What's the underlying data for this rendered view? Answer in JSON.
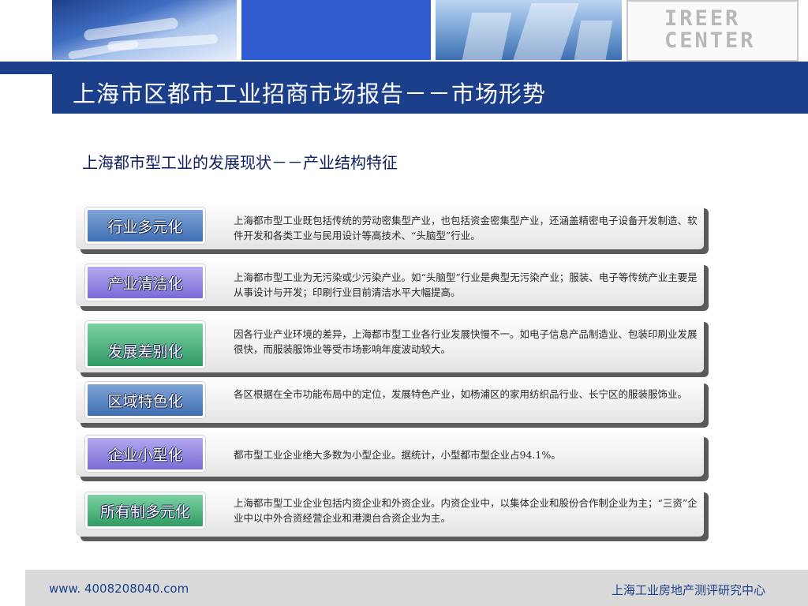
{
  "header": {
    "logo_line1": "IREER",
    "logo_line2": "CENTER",
    "title": "上海市区都市工业招商市场报告－－市场形势"
  },
  "subtitle": "上海都市型工业的发展现状－－产业结构特征",
  "rows": [
    {
      "tag": "行业多元化",
      "desc": "上海都市型工业既包括传统的劳动密集型产业，也包括资金密集型产业，还涵盖精密电子设备开发制造、软件开发和各类工业与民用设计等高技术、“头脑型”行业。"
    },
    {
      "tag": "产业清洁化",
      "desc": "上海都市型工业为无污染或少污染产业。如“头脑型”行业是典型无污染产业；服装、电子等传统产业主要是从事设计与开发；印刷行业目前清洁水平大幅提高。"
    },
    {
      "tag": "发展差别化",
      "desc": "因各行业产业环境的差异，上海都市型工业各行业发展快慢不一。如电子信息产品制造业、包装印刷业发展很快，而服装服饰业等受市场影响年度波动较大。"
    },
    {
      "tag": "区域特色化",
      "desc": "各区根据在全市功能布局中的定位，发展特色产业，如杨浦区的家用纺织品行业、长宁区的服装服饰业。"
    },
    {
      "tag": "企业小型化",
      "desc": "都市型工业企业绝大多数为小型企业。据统计，小型都市型企业占94.1%。"
    },
    {
      "tag": "所有制多元化",
      "desc": "上海都市型工业企业包括内资企业和外资企业。内资企业中，以集体企业和股份合作制企业为主；“三资”企业中以中外合资经营企业和港澳台合资企业为主。"
    }
  ],
  "footer": {
    "url": "www. 4008208040.com",
    "org": "上海工业房地产测评研究中心"
  },
  "colors": {
    "brand_blue": "#1c3f8c",
    "tag_blue": "#3f6fb3",
    "tag_purple": "#7a6bd7",
    "tag_green": "#2f9c63"
  }
}
